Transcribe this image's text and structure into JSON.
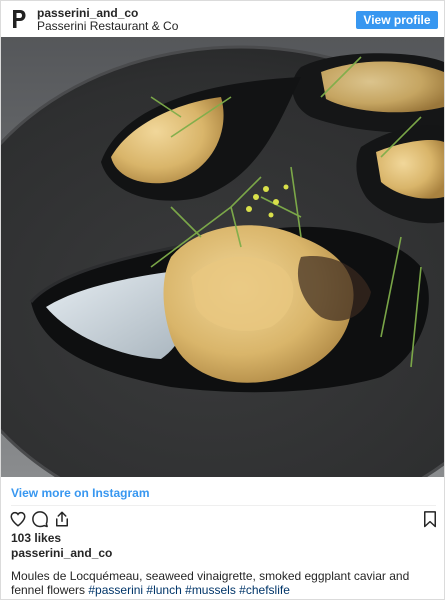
{
  "header": {
    "username": "passerini_and_co",
    "full_name": "Passerini Restaurant & Co",
    "view_profile_label": "View profile",
    "avatar_letter": "P"
  },
  "post": {
    "image_description_icon": "mussels-photo",
    "view_more_label": "View more on Instagram",
    "likes_label": "103 likes",
    "owner": "passerini_and_co",
    "caption_text": "Moules de Locquémeau, seaweed vinaigrette, smoked eggplant caviar and fennel flowers ",
    "hashtags": [
      "#passerini",
      "#lunch",
      "#mussels",
      "#chefslife"
    ]
  },
  "icons": {
    "like": "heart-icon",
    "comment": "comment-icon",
    "share": "share-icon",
    "save": "bookmark-icon"
  },
  "colors": {
    "accent": "#3897f0",
    "hashtag": "#003569",
    "text": "#262626"
  }
}
